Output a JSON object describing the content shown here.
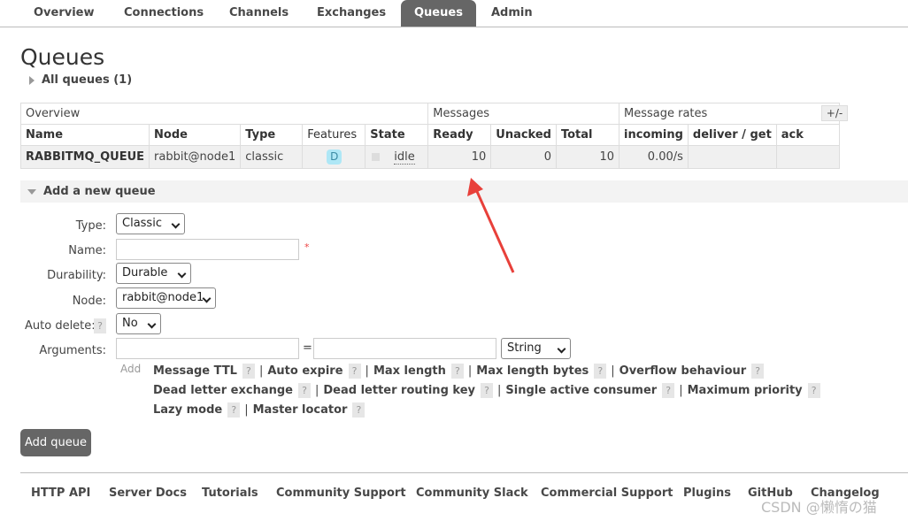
{
  "nav": {
    "tabs": [
      {
        "label": "Overview"
      },
      {
        "label": "Connections"
      },
      {
        "label": "Channels"
      },
      {
        "label": "Exchanges"
      },
      {
        "label": "Queues",
        "active": true
      },
      {
        "label": "Admin"
      }
    ]
  },
  "page": {
    "title": "Queues",
    "all_queues": "All queues (1)"
  },
  "table": {
    "groups": [
      "Overview",
      "Messages",
      "Message rates"
    ],
    "columns": [
      "Name",
      "Node",
      "Type",
      "Features",
      "State",
      "Ready",
      "Unacked",
      "Total",
      "incoming",
      "deliver / get",
      "ack"
    ],
    "plusminus": "+/-",
    "rows": [
      {
        "name": "RABBITMQ_QUEUE",
        "node": "rabbit@node1",
        "type": "classic",
        "feature": "D",
        "state": "idle",
        "ready": "10",
        "unacked": "0",
        "total": "10",
        "incoming": "0.00/s",
        "deliver_get": "",
        "ack": ""
      }
    ]
  },
  "add_queue": {
    "title": "Add a new queue",
    "type_label": "Type:",
    "type_value": "Classic",
    "name_label": "Name:",
    "name_value": "",
    "required_mark": "*",
    "durability_label": "Durability:",
    "durability_value": "Durable",
    "node_label": "Node:",
    "node_value": "rabbit@node1",
    "auto_delete_label": "Auto delete:",
    "auto_delete_value": "No",
    "help_mark": "?",
    "arguments_label": "Arguments:",
    "equals": "=",
    "arg_type_value": "String",
    "add_hint": "Add",
    "arg_rows": [
      [
        "Message TTL",
        "Auto expire",
        "Max length",
        "Max length bytes",
        "Overflow behaviour"
      ],
      [
        "Dead letter exchange",
        "Dead letter routing key",
        "Single active consumer",
        "Maximum priority"
      ],
      [
        "Lazy mode",
        "Master locator"
      ]
    ],
    "separator": "|",
    "button_label": "Add queue"
  },
  "footer": {
    "links": [
      "HTTP API",
      "Server Docs",
      "Tutorials",
      "Community Support",
      "Community Slack",
      "Commercial Support",
      "Plugins",
      "GitHub",
      "Changelog"
    ]
  },
  "watermark": "CSDN @懒惰の猫",
  "colors": {
    "active_tab": "#666666",
    "arrow": "#e8403a",
    "badge": "#aee7f6"
  }
}
